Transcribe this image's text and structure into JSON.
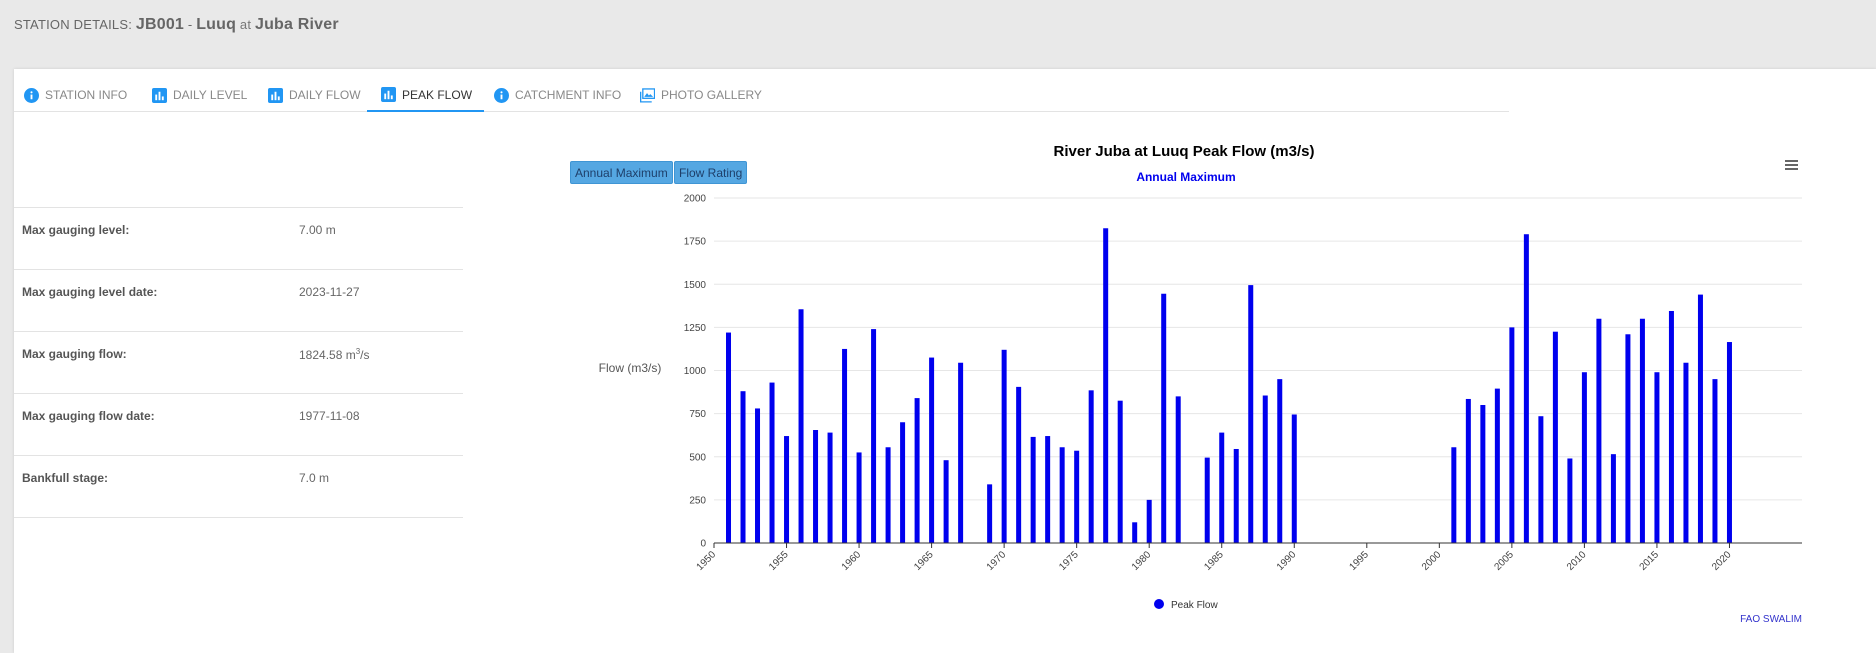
{
  "header": {
    "prefix": "STATION DETAILS:",
    "station_id": "JB001",
    "dash": "-",
    "location": "Luuq",
    "at": "at",
    "river": "Juba River"
  },
  "tabs": [
    {
      "label": "STATION INFO",
      "icon": "info-icon"
    },
    {
      "label": "DAILY LEVEL",
      "icon": "bar-chart-icon"
    },
    {
      "label": "DAILY FLOW",
      "icon": "bar-chart-icon"
    },
    {
      "label": "PEAK FLOW",
      "icon": "bar-chart-icon",
      "active": true
    },
    {
      "label": "CATCHMENT INFO",
      "icon": "info-icon"
    },
    {
      "label": "PHOTO GALLERY",
      "icon": "image-icon"
    }
  ],
  "info": [
    {
      "label": "Max gauging level:",
      "value": "7.00 m"
    },
    {
      "label": "Max gauging level date:",
      "value": "2023-11-27"
    },
    {
      "label": "Max gauging flow:",
      "value": "1824.58 m",
      "unit_sup": "3",
      "unit_tail": "/s"
    },
    {
      "label": "Max gauging flow date:",
      "value": "1977-11-08"
    },
    {
      "label": "Bankfull stage:",
      "value": "7.0 m"
    }
  ],
  "buttons": {
    "annual_max": "Annual Maximum",
    "flow_rating": "Flow Rating"
  },
  "colors": {
    "accent": "#2196f3",
    "series": "#0000ee",
    "credit": "#3333cc"
  },
  "chart_data": {
    "type": "bar",
    "title": "River Juba at Luuq Peak Flow (m3/s)",
    "subtitle": "Annual Maximum",
    "ylabel": "Flow (m3/s)",
    "xlabel": "",
    "ylim": [
      0,
      2000
    ],
    "yticks": [
      0,
      250,
      500,
      750,
      1000,
      1250,
      1500,
      1750,
      2000
    ],
    "xlim": [
      1950,
      2025
    ],
    "xticks": [
      1950,
      1955,
      1960,
      1965,
      1970,
      1975,
      1980,
      1985,
      1990,
      1995,
      2000,
      2005,
      2010,
      2015,
      2020
    ],
    "grid": true,
    "legend": "bottom-center",
    "credits": "FAO SWALIM",
    "series": [
      {
        "name": "Peak Flow",
        "points": [
          [
            1951,
            1220
          ],
          [
            1952,
            880
          ],
          [
            1953,
            780
          ],
          [
            1954,
            930
          ],
          [
            1955,
            620
          ],
          [
            1956,
            1355
          ],
          [
            1957,
            655
          ],
          [
            1958,
            640
          ],
          [
            1959,
            1125
          ],
          [
            1960,
            525
          ],
          [
            1961,
            1240
          ],
          [
            1962,
            555
          ],
          [
            1963,
            700
          ],
          [
            1964,
            840
          ],
          [
            1965,
            1075
          ],
          [
            1966,
            480
          ],
          [
            1967,
            1045
          ],
          [
            1969,
            340
          ],
          [
            1970,
            1120
          ],
          [
            1971,
            905
          ],
          [
            1972,
            615
          ],
          [
            1973,
            620
          ],
          [
            1974,
            555
          ],
          [
            1975,
            535
          ],
          [
            1976,
            885
          ],
          [
            1977,
            1824.58
          ],
          [
            1978,
            825
          ],
          [
            1979,
            120
          ],
          [
            1980,
            250
          ],
          [
            1981,
            1445
          ],
          [
            1982,
            850
          ],
          [
            1984,
            495
          ],
          [
            1985,
            640
          ],
          [
            1986,
            545
          ],
          [
            1987,
            1495
          ],
          [
            1988,
            855
          ],
          [
            1989,
            950
          ],
          [
            1990,
            745
          ],
          [
            2001,
            555
          ],
          [
            2002,
            835
          ],
          [
            2003,
            800
          ],
          [
            2004,
            895
          ],
          [
            2005,
            1250
          ],
          [
            2006,
            1790
          ],
          [
            2007,
            735
          ],
          [
            2008,
            1225
          ],
          [
            2009,
            490
          ],
          [
            2010,
            990
          ],
          [
            2011,
            1300
          ],
          [
            2012,
            515
          ],
          [
            2013,
            1210
          ],
          [
            2014,
            1300
          ],
          [
            2015,
            990
          ],
          [
            2016,
            1345
          ],
          [
            2017,
            1045
          ],
          [
            2018,
            1440
          ],
          [
            2019,
            950
          ],
          [
            2020,
            1165
          ]
        ]
      }
    ]
  }
}
